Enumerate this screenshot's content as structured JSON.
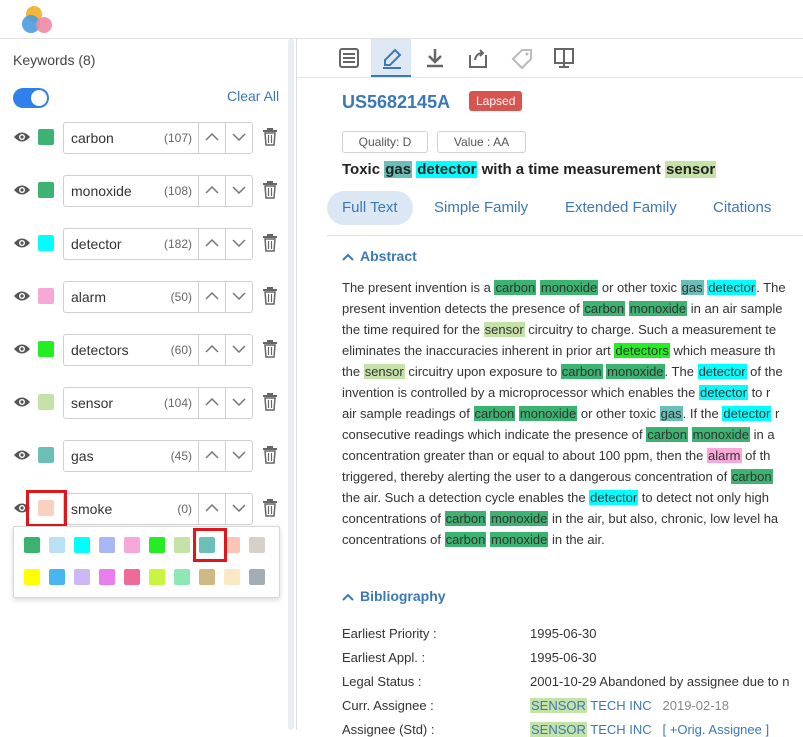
{
  "sidebar": {
    "title": "Keywords (8)",
    "clear_all": "Clear All",
    "keywords": [
      {
        "name": "carbon",
        "count": "(107)",
        "color": "#3cb371"
      },
      {
        "name": "monoxide",
        "count": "(108)",
        "color": "#3cb371"
      },
      {
        "name": "detector",
        "count": "(182)",
        "color": "#00ffff"
      },
      {
        "name": "alarm",
        "count": "(50)",
        "color": "#f7a8d8"
      },
      {
        "name": "detectors",
        "count": "(60)",
        "color": "#22ee22"
      },
      {
        "name": "sensor",
        "count": "(104)",
        "color": "#c5e2a8"
      },
      {
        "name": "gas",
        "count": "(45)",
        "color": "#6bbfb8"
      },
      {
        "name": "smoke",
        "count": "(0)",
        "color": "#fcd0c0"
      }
    ],
    "palette": [
      "#3cb371",
      "#b9e0f5",
      "#00ffff",
      "#a9b8f5",
      "#f7a8d8",
      "#22ee22",
      "#c5e2a8",
      "#6bbfb8",
      "#fcc4b4",
      "#d6d0c8",
      "#ffff00",
      "#47b6ef",
      "#cbb8f5",
      "#e87ded",
      "#ef6a96",
      "#c9f542",
      "#8ee8b4",
      "#ceb883",
      "#fbe8c4",
      "#a3adb4"
    ]
  },
  "toolbar": {
    "icons": [
      "document-icon",
      "highlighter-icon",
      "download-icon",
      "export-icon",
      "tag-icon",
      "compare-icon"
    ]
  },
  "patent": {
    "number": "US5682145A",
    "status": "Lapsed",
    "quality": "Quality: D",
    "value": "Value : AA",
    "title": {
      "t1": "Toxic ",
      "t2": "gas",
      "t3": " ",
      "t4": "detector",
      "t5": " with a time measurement ",
      "t6": "sensor"
    }
  },
  "tabs": [
    "Full Text",
    "Simple Family",
    "Extended Family",
    "Citations"
  ],
  "abstract": {
    "heading": "Abstract",
    "lines": [
      [
        [
          "The present invention is a ",
          ""
        ],
        [
          "carbon",
          "#3cb371"
        ],
        [
          " ",
          ""
        ],
        [
          "monoxide",
          "#3cb371"
        ],
        [
          " or other toxic ",
          ""
        ],
        [
          "gas",
          "#6bbfb8"
        ],
        [
          " ",
          ""
        ],
        [
          "detector",
          "#00ffff"
        ],
        [
          ". The",
          ""
        ]
      ],
      [
        [
          "present invention detects the presence of ",
          ""
        ],
        [
          "carbon",
          "#3cb371"
        ],
        [
          " ",
          ""
        ],
        [
          "monoxide",
          "#3cb371"
        ],
        [
          " in an air sample",
          ""
        ]
      ],
      [
        [
          "the time required for the ",
          ""
        ],
        [
          "sensor",
          "#c5e2a8"
        ],
        [
          " circuitry to charge. Such a measurement te",
          ""
        ]
      ],
      [
        [
          "eliminates the inaccuracies inherent in prior art ",
          ""
        ],
        [
          "detectors",
          "#22ee22"
        ],
        [
          " which measure th",
          ""
        ]
      ],
      [
        [
          "the ",
          ""
        ],
        [
          "sensor",
          "#c5e2a8"
        ],
        [
          " circuitry upon exposure to ",
          ""
        ],
        [
          "carbon",
          "#3cb371"
        ],
        [
          " ",
          ""
        ],
        [
          "monoxide",
          "#3cb371"
        ],
        [
          ". The ",
          ""
        ],
        [
          "detector",
          "#00ffff"
        ],
        [
          " of the",
          ""
        ]
      ],
      [
        [
          "invention is controlled by a microprocessor which enables the ",
          ""
        ],
        [
          "detector",
          "#00ffff"
        ],
        [
          " to r",
          ""
        ]
      ],
      [
        [
          "air sample readings of ",
          ""
        ],
        [
          "carbon",
          "#3cb371"
        ],
        [
          " ",
          ""
        ],
        [
          "monoxide",
          "#3cb371"
        ],
        [
          " or other toxic ",
          ""
        ],
        [
          "gas",
          "#6bbfb8"
        ],
        [
          ". If the ",
          ""
        ],
        [
          "detector",
          "#00ffff"
        ],
        [
          " r",
          ""
        ]
      ],
      [
        [
          "consecutive readings which indicate the presence of ",
          ""
        ],
        [
          "carbon",
          "#3cb371"
        ],
        [
          " ",
          ""
        ],
        [
          "monoxide",
          "#3cb371"
        ],
        [
          " in a",
          ""
        ]
      ],
      [
        [
          "concentration greater than or equal to about 100 ppm, then the ",
          ""
        ],
        [
          "alarm",
          "#f7a8d8"
        ],
        [
          " of th",
          ""
        ]
      ],
      [
        [
          "triggered, thereby alerting the user to a dangerous concentration of ",
          ""
        ],
        [
          "carbon",
          "#3cb371"
        ]
      ],
      [
        [
          "the air. Such a detection cycle enables the ",
          ""
        ],
        [
          "detector",
          "#00ffff"
        ],
        [
          " to detect not only high",
          ""
        ]
      ],
      [
        [
          "concentrations of ",
          ""
        ],
        [
          "carbon",
          "#3cb371"
        ],
        [
          " ",
          ""
        ],
        [
          "monoxide",
          "#3cb371"
        ],
        [
          " in the air, but also, chronic, low level ha",
          ""
        ]
      ],
      [
        [
          "concentrations of ",
          ""
        ],
        [
          "carbon",
          "#3cb371"
        ],
        [
          " ",
          ""
        ],
        [
          "monoxide",
          "#3cb371"
        ],
        [
          " in the air.",
          ""
        ]
      ]
    ]
  },
  "bibliography": {
    "heading": "Bibliography",
    "rows": [
      {
        "label": "Earliest Priority :",
        "value": "1995-06-30"
      },
      {
        "label": "Earliest Appl. :",
        "value": "1995-06-30"
      },
      {
        "label": "Legal Status :",
        "value": "2001-10-29 Abandoned by assignee due to n"
      },
      {
        "label": "Curr. Assignee :",
        "v1": "SENSOR",
        "v2": " TECH INC",
        "v3": "2019-02-18"
      },
      {
        "label": "Assignee (Std) :",
        "v1": "SENSOR",
        "v2": " TECH INC",
        "v3": "[ +Orig. Assignee ]"
      }
    ]
  }
}
